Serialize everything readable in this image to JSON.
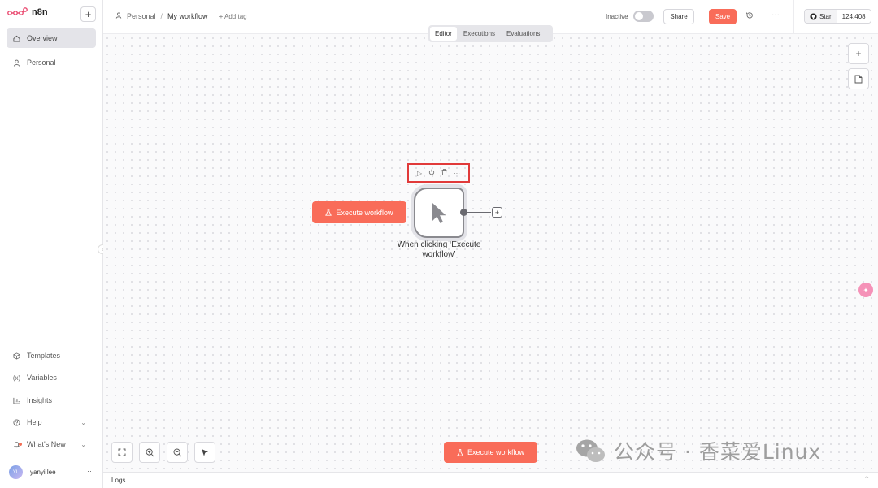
{
  "sidebar": {
    "brand": "n8n",
    "add_label": "+",
    "items": [
      {
        "label": "Overview",
        "icon": "home-icon"
      },
      {
        "label": "Personal",
        "icon": "user-icon"
      }
    ],
    "bottom_items": [
      {
        "label": "Templates",
        "icon": "box-icon"
      },
      {
        "label": "Variables",
        "icon": "variable-icon"
      },
      {
        "label": "Insights",
        "icon": "chart-icon"
      },
      {
        "label": "Help",
        "icon": "help-icon"
      },
      {
        "label": "What's New",
        "icon": "bell-icon"
      }
    ],
    "user": {
      "initials": "YL",
      "name": "yanyi lee",
      "more": "···"
    }
  },
  "header": {
    "breadcrumb_project": "Personal",
    "breadcrumb_sep": "/",
    "workflow_title": "My workflow",
    "add_tag": "+ Add tag",
    "status_label": "Inactive",
    "share_label": "Share",
    "save_label": "Save",
    "more_label": "···",
    "github_star": "Star",
    "github_count": "124,408"
  },
  "tabs": [
    "Editor",
    "Executions",
    "Evaluations"
  ],
  "canvas": {
    "execute_label": "Execute workflow",
    "node_label": "When clicking ‘Execute workflow’",
    "node_plus": "+",
    "zoom_plus": "+",
    "watermark": "公众号 · 香菜爱Linux"
  },
  "logs": {
    "label": "Logs",
    "chev": "⌃"
  },
  "colors": {
    "accent": "#f96c59",
    "highlight_border": "#e13a3a"
  }
}
